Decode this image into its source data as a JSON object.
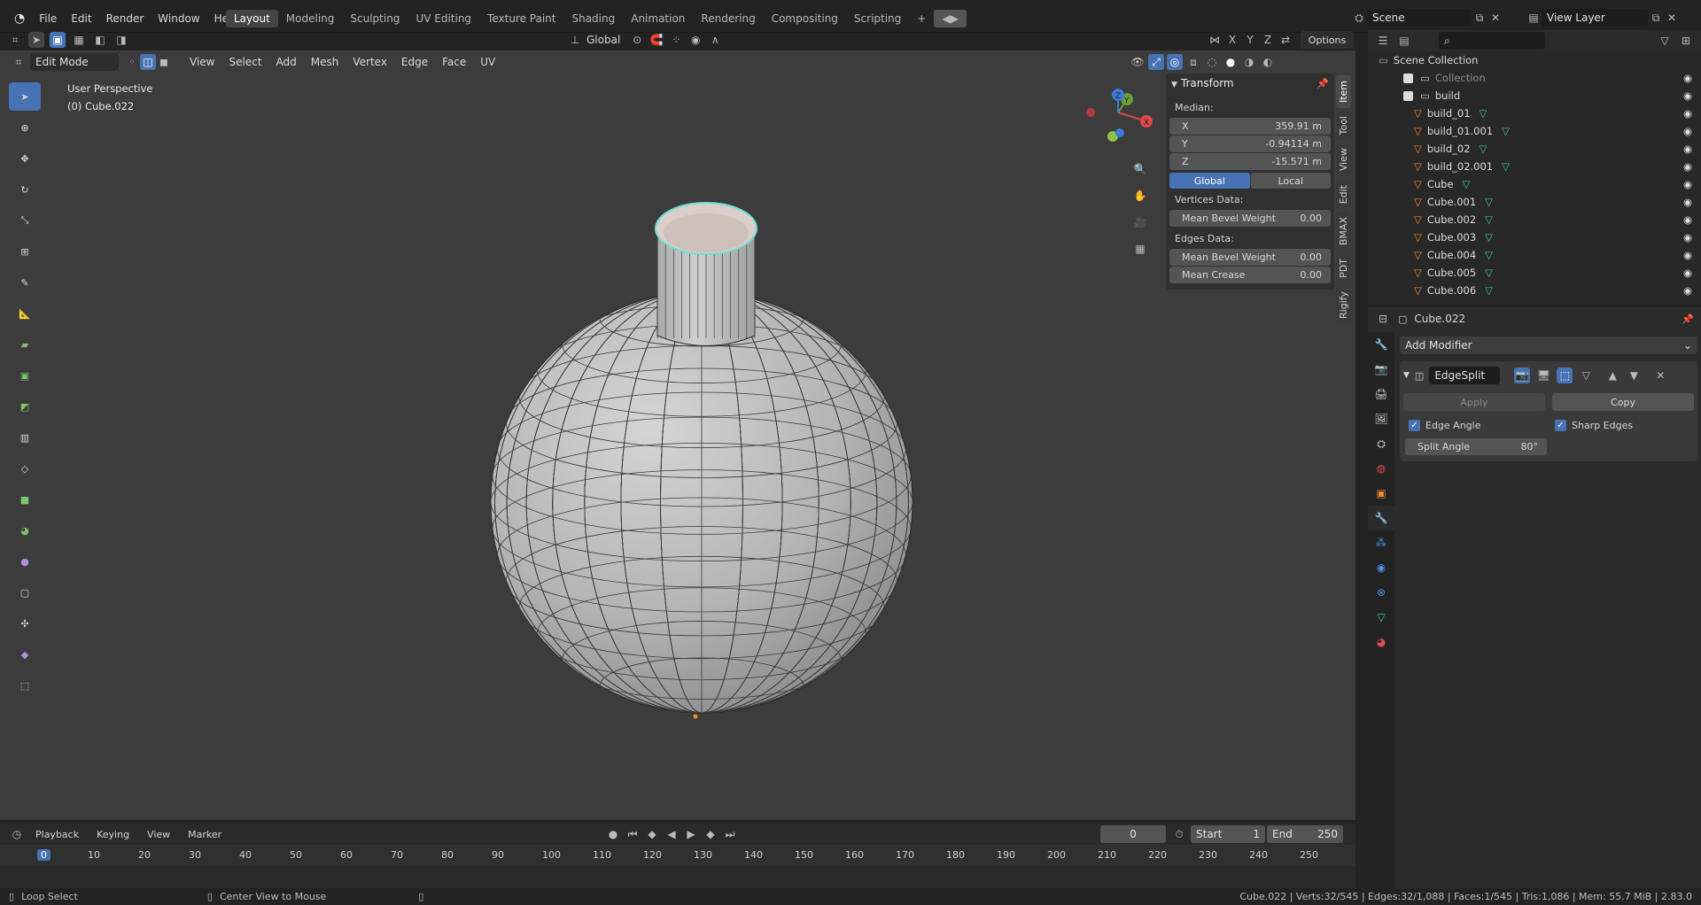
{
  "menu": {
    "items": [
      "File",
      "Edit",
      "Render",
      "Window",
      "Help"
    ]
  },
  "workspaces": [
    "Layout",
    "Modeling",
    "Sculpting",
    "UV Editing",
    "Texture Paint",
    "Shading",
    "Animation",
    "Rendering",
    "Compositing",
    "Scripting"
  ],
  "workspace_active": "Layout",
  "scene": {
    "name": "Scene",
    "view_layer": "View Layer"
  },
  "header": {
    "mode": "Edit Mode",
    "menus": [
      "View",
      "Select",
      "Add",
      "Mesh",
      "Vertex",
      "Edge",
      "Face",
      "UV"
    ],
    "transform_orientation": "Global",
    "axis": [
      "X",
      "Y",
      "Z"
    ],
    "options": "Options"
  },
  "viewport": {
    "title": "User Perspective",
    "object": "(0) Cube.022"
  },
  "npanel": {
    "section": "Transform",
    "median_label": "Median:",
    "x_label": "X",
    "x": "359.91 m",
    "y_label": "Y",
    "y": "-0.94114 m",
    "z_label": "Z",
    "z": "-15.571 m",
    "global": "Global",
    "local": "Local",
    "vertices_data": "Vertices Data:",
    "mean_bevel_weight": "Mean Bevel Weight",
    "vbw": "0.00",
    "edges_data": "Edges Data:",
    "ebw": "0.00",
    "mean_crease": "Mean Crease",
    "crease": "0.00"
  },
  "sidetabs": [
    "Item",
    "Tool",
    "View",
    "Edit",
    "BMAX",
    "PDT",
    "Rigify"
  ],
  "outliner": {
    "root": "Scene Collection",
    "items": [
      {
        "name": "Collection",
        "level": 1
      },
      {
        "name": "build",
        "level": 1
      },
      {
        "name": "build_01",
        "level": 2
      },
      {
        "name": "build_01.001",
        "level": 2
      },
      {
        "name": "build_02",
        "level": 2
      },
      {
        "name": "build_02.001",
        "level": 2
      },
      {
        "name": "Cube",
        "level": 2
      },
      {
        "name": "Cube.001",
        "level": 2
      },
      {
        "name": "Cube.002",
        "level": 2
      },
      {
        "name": "Cube.003",
        "level": 2
      },
      {
        "name": "Cube.004",
        "level": 2
      },
      {
        "name": "Cube.005",
        "level": 2
      },
      {
        "name": "Cube.006",
        "level": 2
      }
    ]
  },
  "properties": {
    "object": "Cube.022",
    "add_modifier": "Add Modifier",
    "modifier_name": "EdgeSplit",
    "apply": "Apply",
    "copy": "Copy",
    "edge_angle": "Edge Angle",
    "sharp_edges": "Sharp Edges",
    "split_angle_label": "Split Angle",
    "split_angle": "80°"
  },
  "timeline": {
    "menus": [
      "Playback",
      "Keying",
      "View",
      "Marker"
    ],
    "current_frame": "0",
    "start_label": "Start",
    "start": "1",
    "end_label": "End",
    "end": "250",
    "ticks": [
      "0",
      "10",
      "20",
      "30",
      "40",
      "50",
      "60",
      "70",
      "80",
      "90",
      "100",
      "110",
      "120",
      "130",
      "140",
      "150",
      "160",
      "170",
      "180",
      "190",
      "200",
      "210",
      "220",
      "230",
      "240",
      "250"
    ]
  },
  "status": {
    "left": "Loop Select",
    "middle": "Center View to Mouse",
    "right": "Cube.022 | Verts:32/545 | Edges:32/1,088 | Faces:1/545 | Tris:1,086 | Mem: 55.7 MiB | 2.83.0"
  },
  "colors": {
    "accent": "#4772b3",
    "selection_edge": "#6bdfd0",
    "vertex_active": "#ff8a1f"
  }
}
